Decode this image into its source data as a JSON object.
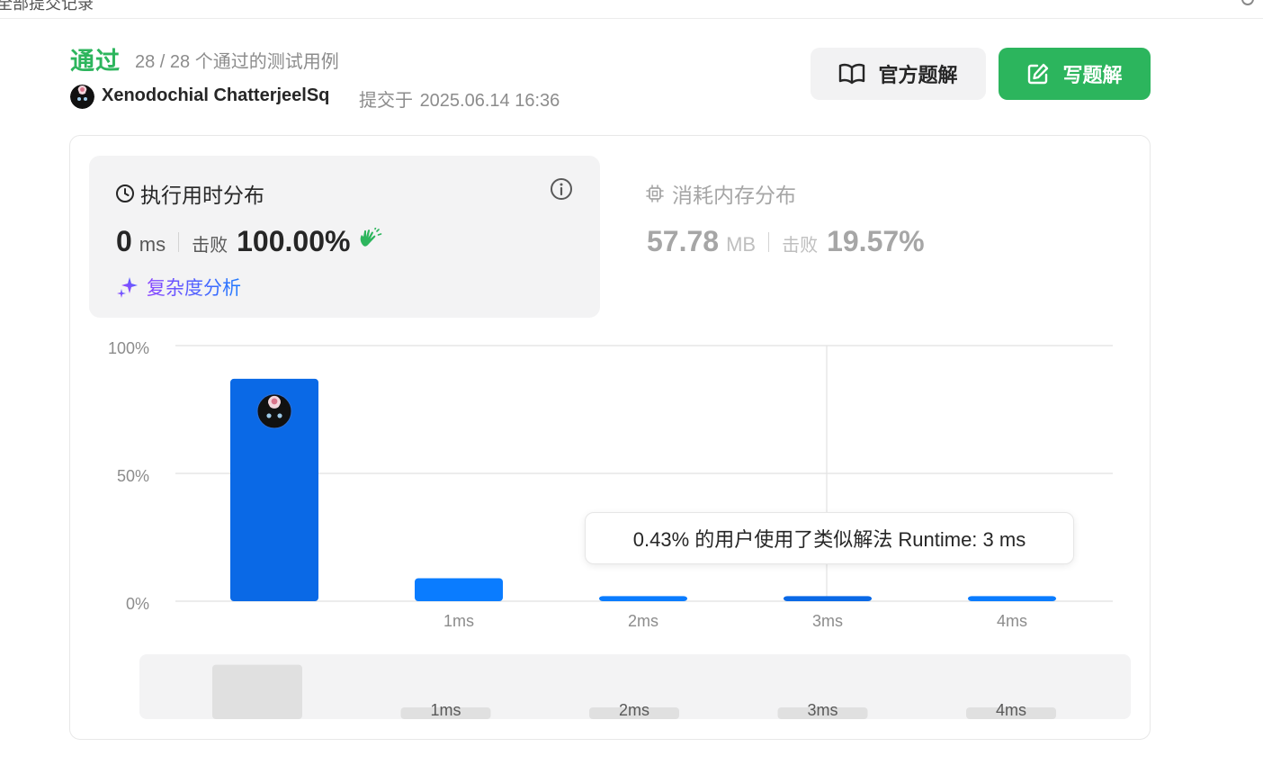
{
  "topbar": {
    "crumb": "全部提交记录"
  },
  "result": {
    "status": "通过",
    "cases": "28 / 28 个通过的测试用例",
    "user": "Xenodochial ChatterjeelSq",
    "submit_label": "提交于",
    "submit_time": "2025.06.14 16:36"
  },
  "buttons": {
    "official": "官方题解",
    "write": "写题解"
  },
  "runtime": {
    "title": "执行用时分布",
    "value": "0",
    "unit": "ms",
    "beat_label": "击败",
    "beat_value": "100.00%",
    "complexity_link": "复杂度分析"
  },
  "memory": {
    "title": "消耗内存分布",
    "value": "57.78",
    "unit": "MB",
    "beat_label": "击败",
    "beat_value": "19.57%"
  },
  "tooltip": {
    "text": "0.43% 的用户使用了类似解法 Runtime: 3 ms"
  },
  "colors": {
    "accent_green": "#2db55d",
    "bar_blue": "#0a7cff",
    "bar_blue_dark": "#0a69e6"
  },
  "chart_data": {
    "type": "bar",
    "ylabel_ticks": [
      "100%",
      "50%",
      "0%"
    ],
    "ylim": [
      0,
      100
    ],
    "categories": [
      "",
      "1ms",
      "2ms",
      "3ms",
      "4ms"
    ],
    "values": [
      87,
      9,
      2,
      2,
      2
    ],
    "highlight_index": 0,
    "hover_index": 3,
    "grid": true
  },
  "overview": {
    "categories": [
      "",
      "1ms",
      "2ms",
      "3ms",
      "4ms"
    ]
  }
}
